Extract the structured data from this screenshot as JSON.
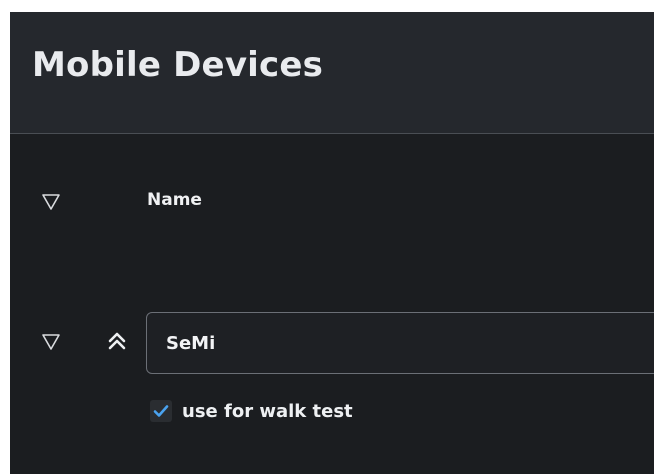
{
  "panel": {
    "title": "Mobile Devices"
  },
  "table": {
    "column_name": "Name",
    "filter_icon": "filter-triangle-icon"
  },
  "device": {
    "name_value": "SeMi",
    "collapse_icon": "double-chevron-up-icon",
    "expand_icon": "triangle-down-icon",
    "walk_test_label": "use for walk test",
    "walk_test_checked": true
  },
  "colors": {
    "background": "#1b1d20",
    "header": "#25282d",
    "text": "#e9ebee",
    "check_accent": "#4aa3f0"
  }
}
